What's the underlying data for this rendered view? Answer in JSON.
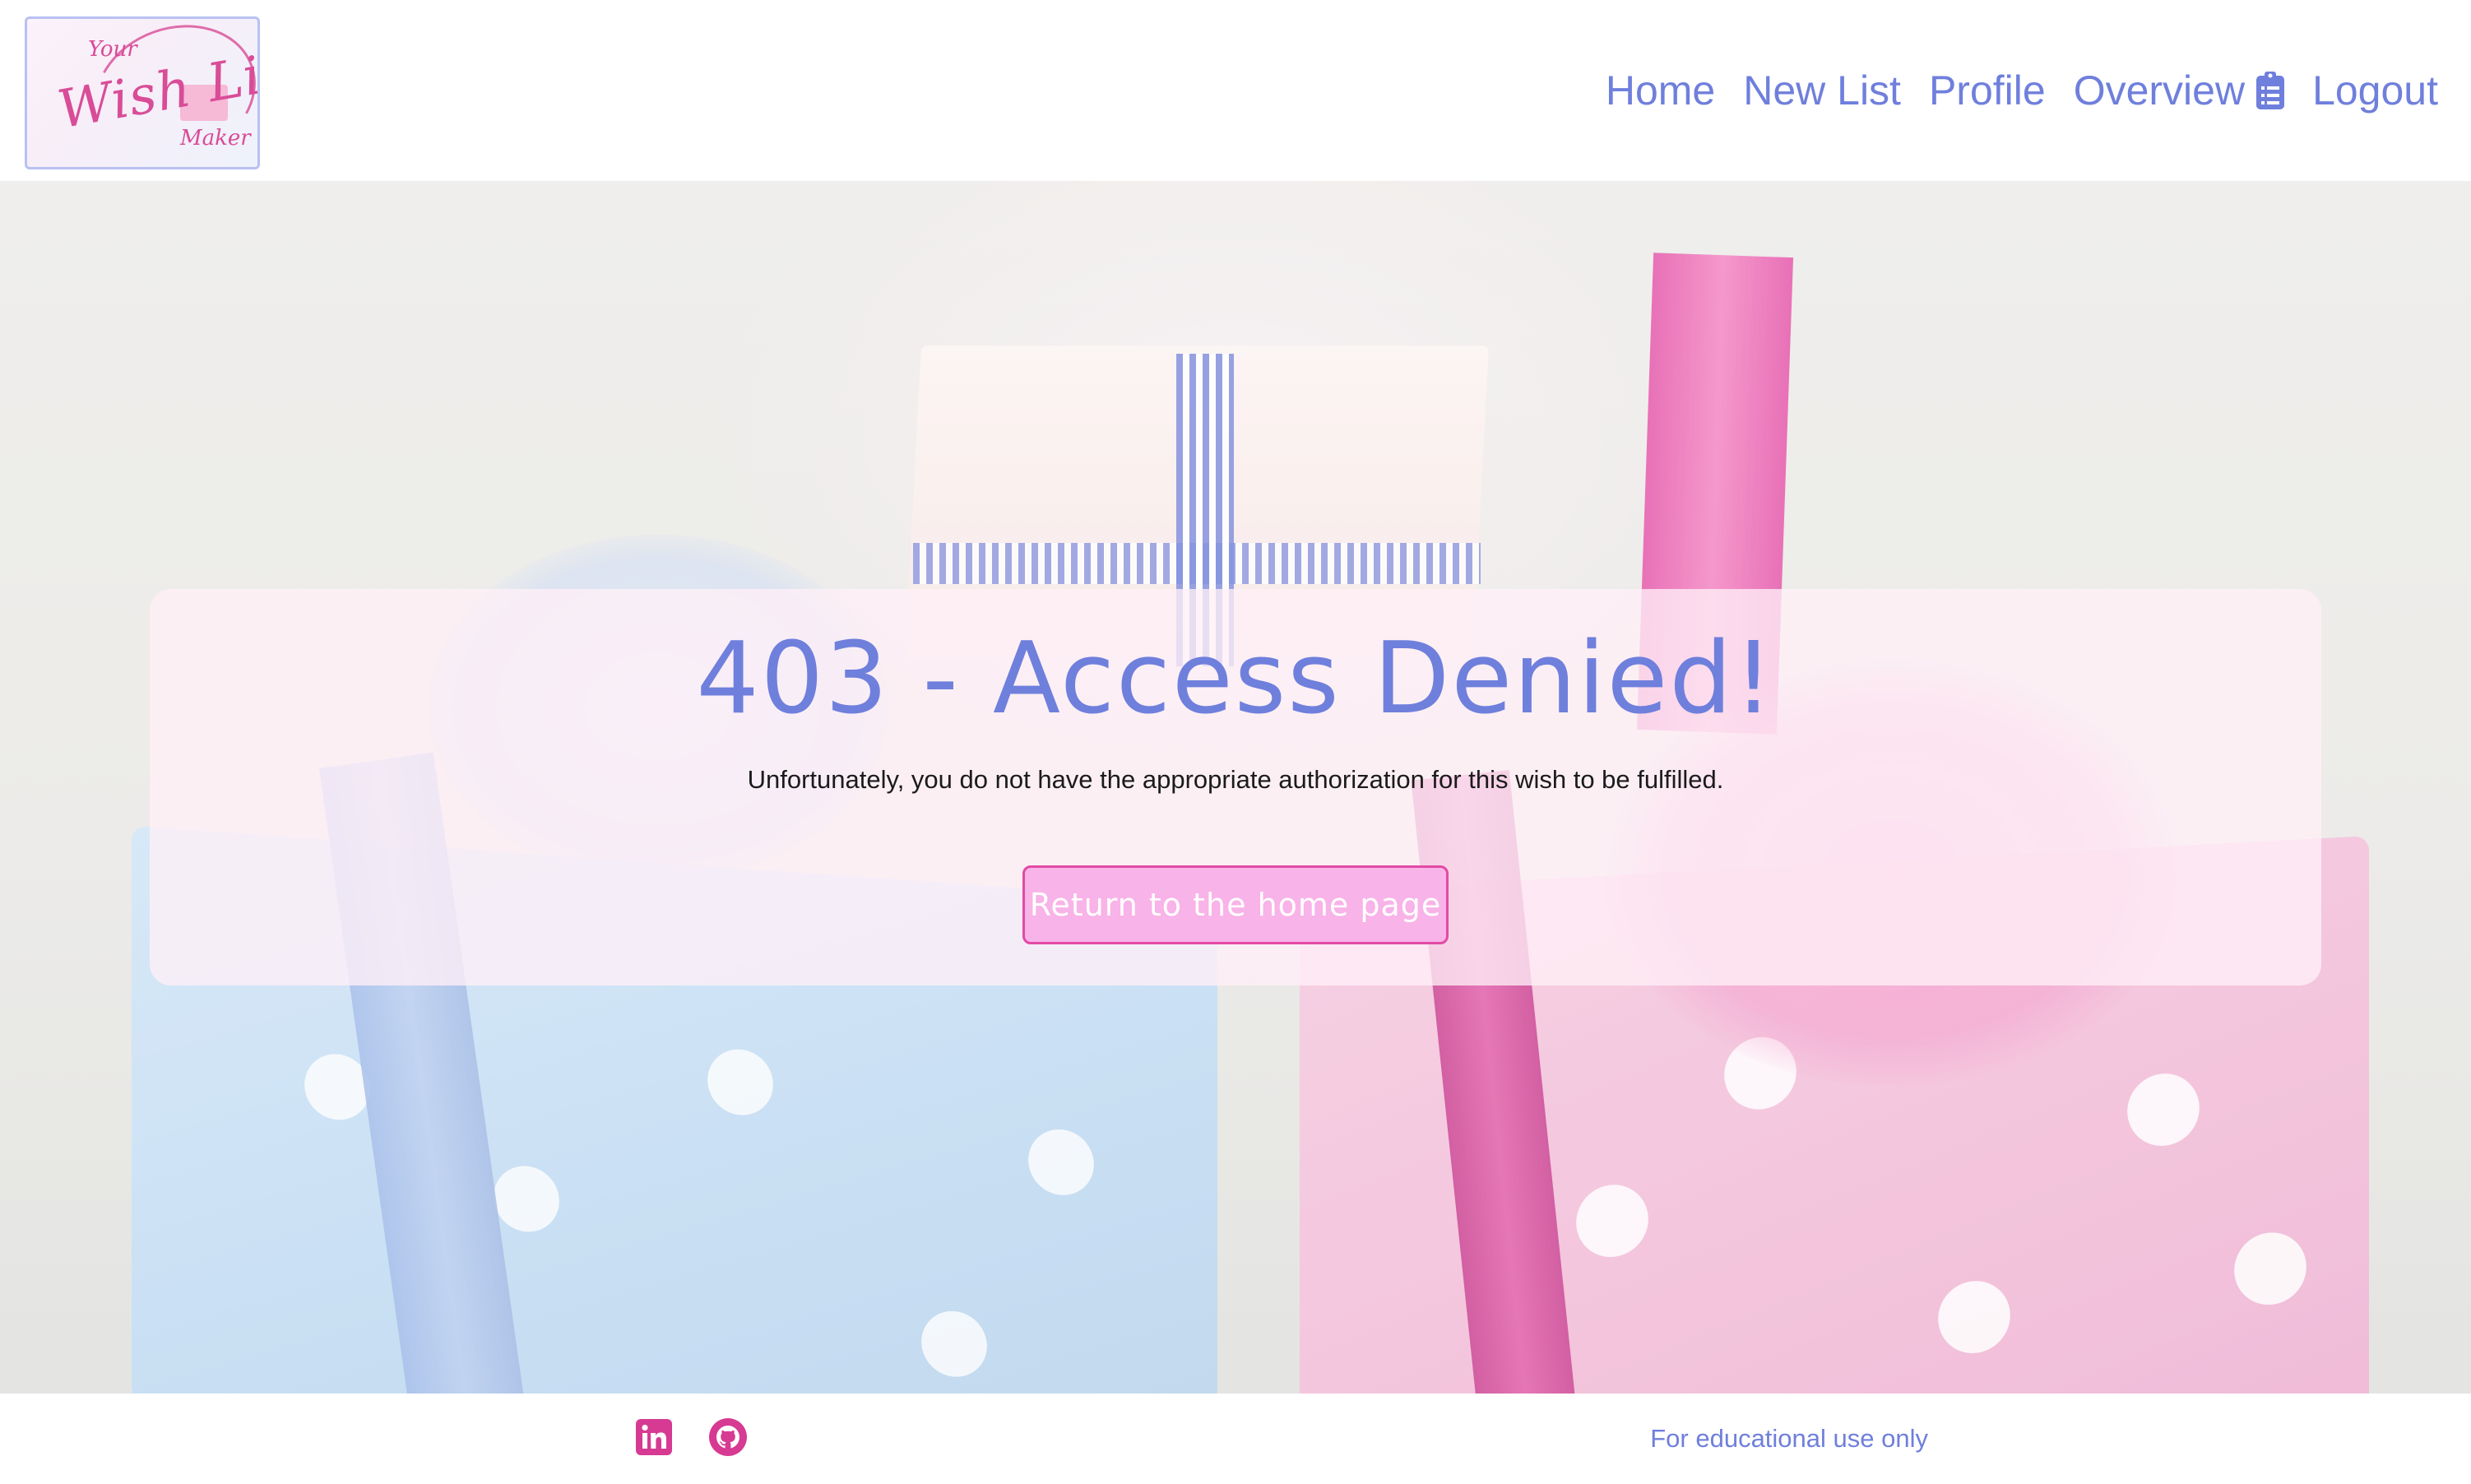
{
  "header": {
    "logo_alt": "Your Wish List Maker",
    "logo_text": {
      "top": "Your",
      "main": "Wish List",
      "bottom": "Maker"
    },
    "nav": [
      {
        "label": "Home"
      },
      {
        "label": "New List"
      },
      {
        "label": "Profile"
      },
      {
        "label": "Overview",
        "icon": "clipboard-list-icon"
      },
      {
        "label": "Logout"
      }
    ]
  },
  "error_card": {
    "title": "403 - Access Denied!",
    "message": "Unfortunately, you do not have the appropriate authorization for this wish to be fulfilled.",
    "button_label": "Return to the home page"
  },
  "footer": {
    "icons": [
      "linkedin-icon",
      "github-icon"
    ],
    "text": "For educational use only"
  },
  "colors": {
    "accent_blue": "#6f7fdc",
    "accent_pink": "#e24aa5",
    "button_fill": "#f8b3e8"
  }
}
